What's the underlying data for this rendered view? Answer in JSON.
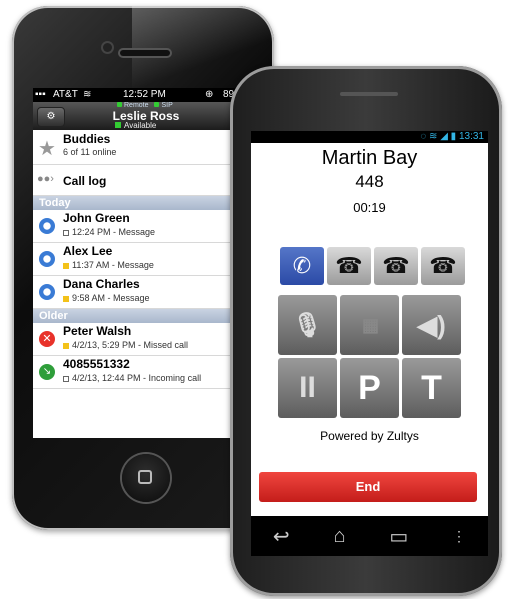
{
  "iphone": {
    "status": {
      "carrier": "AT&T",
      "time": "12:52 PM",
      "battery": "89%"
    },
    "header": {
      "remote": "Remote",
      "sip": "SIP",
      "user_name": "Leslie Ross",
      "availability": "Available"
    },
    "buddies": {
      "title": "Buddies",
      "subtitle": "6 of 11 online"
    },
    "call_log": {
      "title": "Call log"
    },
    "sections": {
      "today": "Today",
      "older": "Older"
    },
    "today_items": [
      {
        "name": "John Green",
        "detail": "12:24 PM - Message"
      },
      {
        "name": "Alex Lee",
        "detail": "11:37 AM - Message"
      },
      {
        "name": "Dana Charles",
        "detail": "9:58 AM - Message"
      }
    ],
    "older_items": [
      {
        "name": "Peter Walsh",
        "detail": "4/2/13, 5:29 PM - Missed call"
      },
      {
        "name": "4085551332",
        "detail": "4/2/13, 12:44 PM - Incoming call"
      }
    ]
  },
  "android": {
    "status_time": "13:31",
    "caller_name": "Martin Bay",
    "extension": "448",
    "duration": "00:19",
    "buttons": {
      "pause": "II",
      "park": "P",
      "transfer": "T"
    },
    "powered_by": "Powered by Zultys",
    "end_label": "End"
  }
}
